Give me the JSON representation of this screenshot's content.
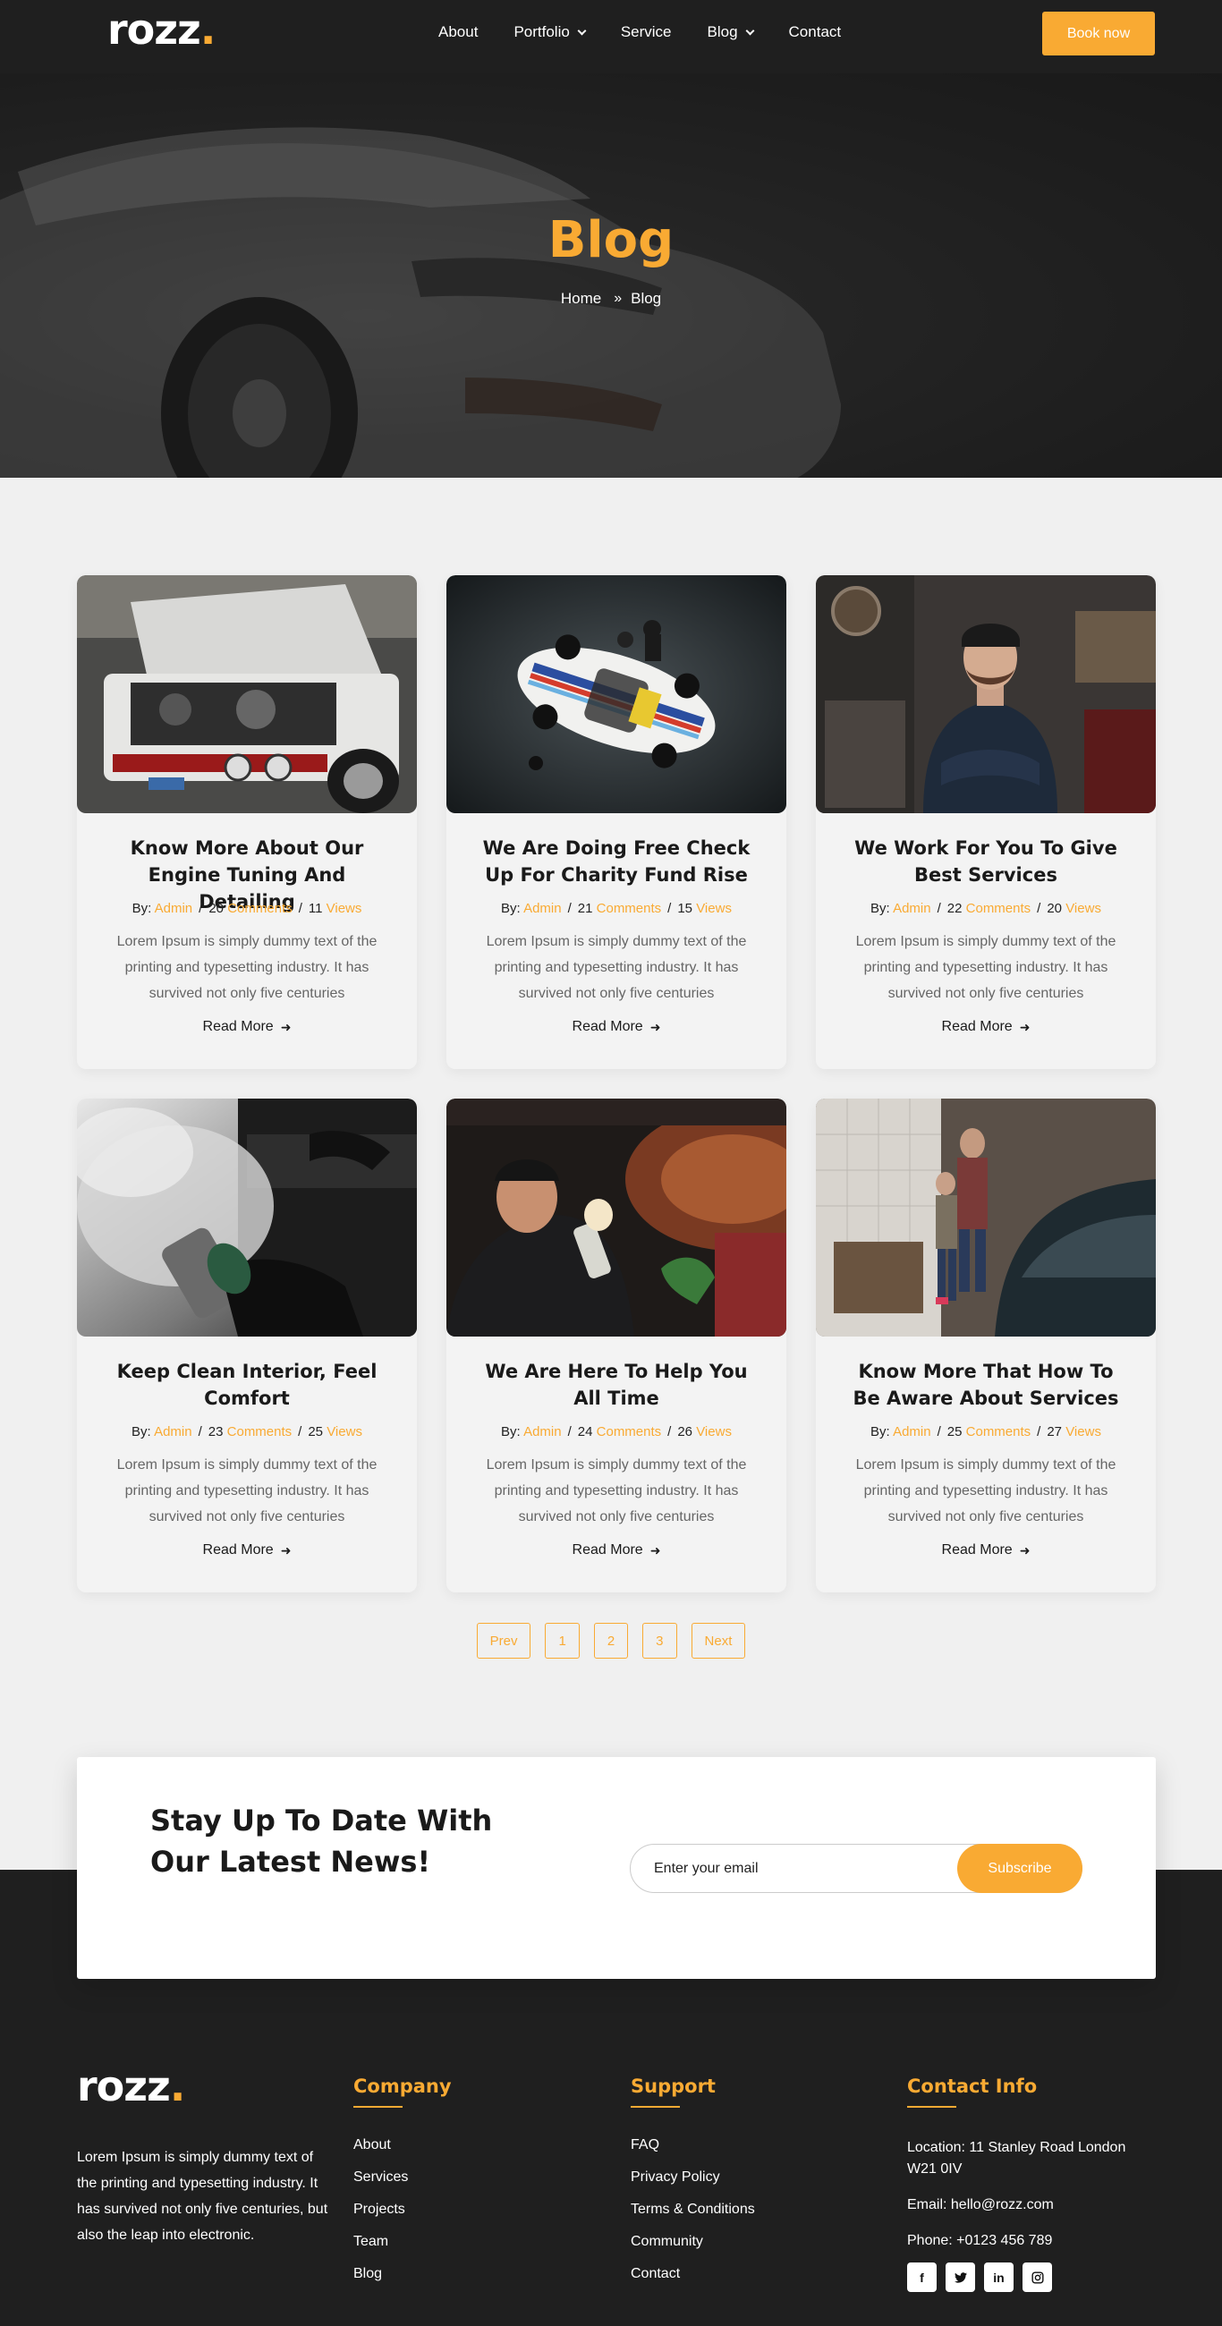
{
  "colors": {
    "accent": "#f9aa33",
    "dark": "#1f1f1f",
    "background": "#f0f0f0"
  },
  "header": {
    "logo": "rozz",
    "logo_dot": ".",
    "nav": [
      {
        "label": "About",
        "has_dropdown": false
      },
      {
        "label": "Portfolio",
        "has_dropdown": true
      },
      {
        "label": "Service",
        "has_dropdown": false
      },
      {
        "label": "Blog",
        "has_dropdown": true
      },
      {
        "label": "Contact",
        "has_dropdown": false
      }
    ],
    "book_label": "Book now"
  },
  "hero": {
    "title": "Blog",
    "breadcrumb_home": "Home",
    "breadcrumb_current": "Blog"
  },
  "posts": [
    {
      "title": "Know More About Our Engine Tuning And Detailing",
      "by": "By:",
      "author": "Admin",
      "comments_count": "20",
      "comments_label": "Comments",
      "views_count": "11",
      "views_label": "Views",
      "excerpt": "Lorem Ipsum is simply dummy text of the printing and typesetting industry. It has survived not only five centuries",
      "read_more": "Read More",
      "image": "engine-photo"
    },
    {
      "title": "We Are Doing Free Check Up For Charity Fund Rise",
      "by": "By:",
      "author": "Admin",
      "comments_count": "21",
      "comments_label": "Comments",
      "views_count": "15",
      "views_label": "Views",
      "excerpt": "Lorem Ipsum is simply dummy text of the printing and typesetting industry. It has survived not only five centuries",
      "read_more": "Read More",
      "image": "race-car-photo"
    },
    {
      "title": "We Work For You To Give Best Services",
      "by": "By:",
      "author": "Admin",
      "comments_count": "22",
      "comments_label": "Comments",
      "views_count": "20",
      "views_label": "Views",
      "excerpt": "Lorem Ipsum is simply dummy text of the printing and typesetting industry. It has survived not only five centuries",
      "read_more": "Read More",
      "image": "mechanic-photo"
    },
    {
      "title": "Keep Clean Interior, Feel Comfort",
      "by": "By:",
      "author": "Admin",
      "comments_count": "23",
      "comments_label": "Comments",
      "views_count": "25",
      "views_label": "Views",
      "excerpt": "Lorem Ipsum is simply dummy text of the printing and typesetting industry. It has survived not only five centuries",
      "read_more": "Read More",
      "image": "steam-clean-photo"
    },
    {
      "title": "We Are Here To Help You All Time",
      "by": "By:",
      "author": "Admin",
      "comments_count": "24",
      "comments_label": "Comments",
      "views_count": "26",
      "views_label": "Views",
      "excerpt": "Lorem Ipsum is simply dummy text of the printing and typesetting industry. It has survived not only five centuries",
      "read_more": "Read More",
      "image": "under-car-photo"
    },
    {
      "title": "Know More That How To Be Aware About Services",
      "by": "By:",
      "author": "Admin",
      "comments_count": "25",
      "comments_label": "Comments",
      "views_count": "27",
      "views_label": "Views",
      "excerpt": "Lorem Ipsum is simply dummy text of the printing and typesetting industry. It has survived not only five centuries",
      "read_more": "Read More",
      "image": "garage-photo"
    }
  ],
  "pagination": {
    "prev": "Prev",
    "pages": [
      "1",
      "2",
      "3"
    ],
    "next": "Next"
  },
  "newsletter": {
    "title": "Stay Up To Date With Our Latest News!",
    "placeholder": "Enter your email",
    "button": "Subscribe"
  },
  "footer": {
    "logo": "rozz",
    "logo_dot": ".",
    "about": "Lorem Ipsum is simply dummy text of the printing and typesetting industry. It has survived not only five centuries, but also the leap into electronic.",
    "company": {
      "heading": "Company",
      "links": [
        "About",
        "Services",
        "Projects",
        "Team",
        "Blog"
      ]
    },
    "support": {
      "heading": "Support",
      "links": [
        "FAQ",
        "Privacy Policy",
        "Terms & Conditions",
        "Community",
        "Contact"
      ]
    },
    "contact": {
      "heading": "Contact Info",
      "location": "Location: 11 Stanley Road London W21 0IV",
      "email": "Email:  hello@rozz.com",
      "phone": "Phone:  +0123 456 789",
      "socials": [
        "facebook-icon",
        "twitter-icon",
        "linkedin-icon",
        "instagram-icon"
      ]
    }
  }
}
